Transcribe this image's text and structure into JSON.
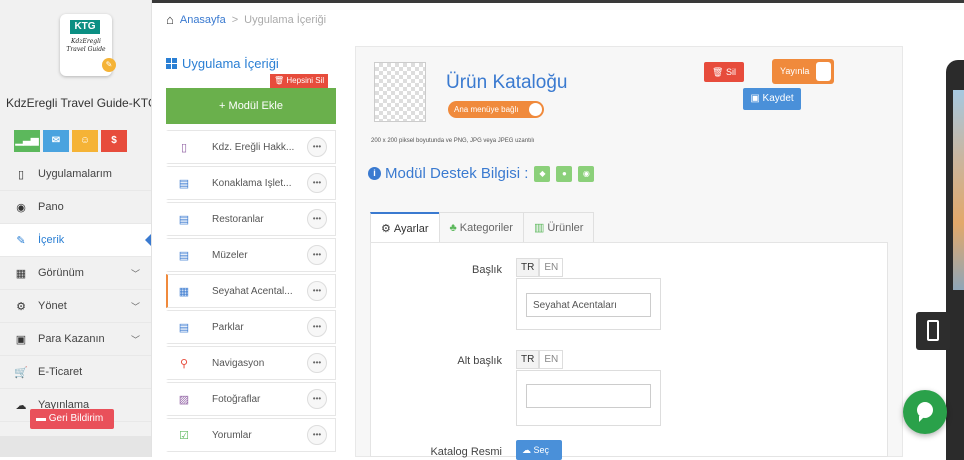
{
  "sidebar": {
    "app_icon": {
      "badge": "KTG",
      "subtitle": "KdzEregli Travel Guide"
    },
    "app_name": "KdzEregli Travel Guide-KTG",
    "quick_buttons": [
      {
        "icon": "stats-icon",
        "glyph": "▁▃▅",
        "color": "#5cb85c"
      },
      {
        "icon": "mail-icon",
        "glyph": "✉",
        "color": "#4aa3df"
      },
      {
        "icon": "user-icon",
        "glyph": "☺",
        "color": "#f5b336"
      },
      {
        "icon": "dollar-icon",
        "glyph": "$",
        "color": "#e74c3c"
      }
    ],
    "menu": [
      {
        "label": "Uygulamalarım",
        "icon": "▯",
        "chevron": false,
        "active": false
      },
      {
        "label": "Pano",
        "icon": "◉",
        "chevron": false,
        "active": false
      },
      {
        "label": "İçerik",
        "icon": "✎",
        "chevron": false,
        "active": true
      },
      {
        "label": "Görünüm",
        "icon": "▦",
        "chevron": true,
        "active": false
      },
      {
        "label": "Yönet",
        "icon": "⚙",
        "chevron": true,
        "active": false
      },
      {
        "label": "Para Kazanın",
        "icon": "▣",
        "chevron": true,
        "active": false
      },
      {
        "label": "E-Ticaret",
        "icon": "🛒",
        "chevron": false,
        "active": false
      },
      {
        "label": "Yayınlama",
        "icon": "☁",
        "chevron": false,
        "active": false
      }
    ],
    "feedback_label": "Geri Bildirim"
  },
  "breadcrumb": {
    "home": "Anasayfa",
    "separator": ">",
    "current": "Uygulama İçeriği"
  },
  "modules": {
    "title": "Uygulama İçeriği",
    "delete_all": "Hepsini Sil",
    "add_module": "+ Modül Ekle",
    "items": [
      {
        "label": "Kdz. Ereğli Hakk...",
        "icon": "▯",
        "icon_color": "#8e5ea2",
        "selected": false
      },
      {
        "label": "Konaklama İşlet...",
        "icon": "▤",
        "icon_color": "#3a7ad0",
        "selected": false
      },
      {
        "label": "Restoranlar",
        "icon": "▤",
        "icon_color": "#3a7ad0",
        "selected": false
      },
      {
        "label": "Müzeler",
        "icon": "▤",
        "icon_color": "#3a7ad0",
        "selected": false
      },
      {
        "label": "Seyahat Acental...",
        "icon": "▦",
        "icon_color": "#3a7ad0",
        "selected": true
      },
      {
        "label": "Parklar",
        "icon": "▤",
        "icon_color": "#3a7ad0",
        "selected": false
      },
      {
        "label": "Navigasyon",
        "icon": "⚲",
        "icon_color": "#e74c3c",
        "selected": false
      },
      {
        "label": "Fotoğraflar",
        "icon": "▨",
        "icon_color": "#8e5ea2",
        "selected": false
      },
      {
        "label": "Yorumlar",
        "icon": "☑",
        "icon_color": "#5cb85c",
        "selected": false
      }
    ],
    "more_glyph": "•••"
  },
  "editor": {
    "title": "Ürün Kataloğu",
    "main_menu_toggle": "Ana menüye bağlı",
    "size_note": "200 x 200 piksel boyutunda ve PNG, JPG veya JPEG uzantılı",
    "delete_label": "Sil",
    "publish_label": "Yayınla",
    "save_label": "Kaydet",
    "support_title": "Modül Destek Bilgisi :",
    "tabs": [
      {
        "label": "Ayarlar",
        "icon": "⚙",
        "active": true
      },
      {
        "label": "Kategoriler",
        "icon": "♣",
        "active": false
      },
      {
        "label": "Ürünler",
        "icon": "▥",
        "active": false
      }
    ],
    "fields": {
      "title_label": "Başlık",
      "title_value": "Seyahat Acentaları",
      "subtitle_label": "Alt başlık",
      "subtitle_value": "",
      "lang_tr": "TR",
      "lang_en": "EN",
      "catalog_image_label": "Katalog Resmi",
      "choose_label": "Seç"
    }
  },
  "colors": {
    "accent_blue": "#3a7ad0",
    "orange": "#f08a3c",
    "green": "#6ab04c",
    "red": "#e74c3c"
  }
}
